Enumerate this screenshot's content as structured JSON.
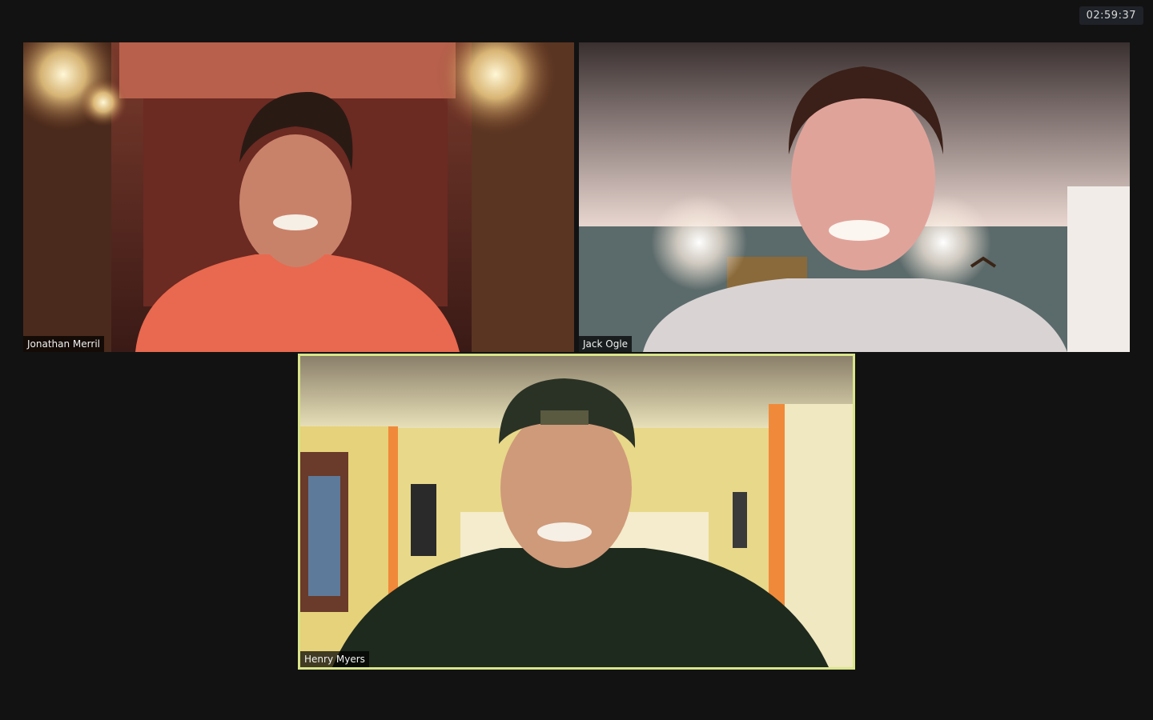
{
  "meeting": {
    "elapsed_time": "02:59:37"
  },
  "participants": [
    {
      "name": "Jonathan Merril"
    },
    {
      "name": "Jack Ogle"
    },
    {
      "name": "Henry Myers",
      "active_speaker": true,
      "highlight_color": "#d9e58a"
    }
  ]
}
